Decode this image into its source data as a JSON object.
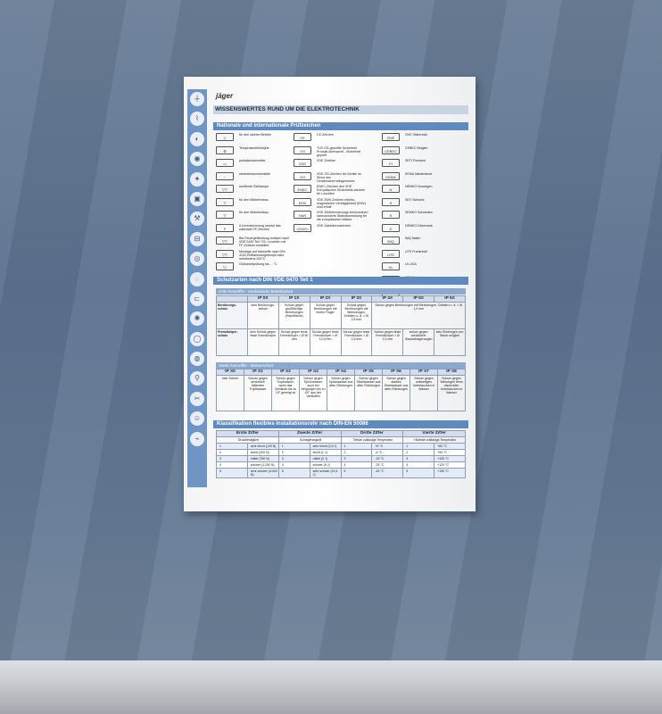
{
  "sheet": {
    "logo": "jäger",
    "main_title": "WISSENSWERTES RUND UM DIE ELEKTROTECHNIK",
    "sec1_title": "Nationale und internationale Prüfzeichen",
    "sec2_title": "Schutzarten nach DIN VDE 0470 Teil 1",
    "sec2_sub1": "erste Kennziffer - mechanische Belastbarkeit",
    "sec2_sub2": "zweite Kennziffer - Wasserschutz",
    "sec3_title": "Klassifikation flexibles Installationsrohr nach DIN-EN 50086"
  },
  "sidebar_icons": [
    "plug-icon",
    "cable-icon",
    "switch-icon",
    "socket-icon",
    "lamp-icon",
    "box-icon",
    "tool-icon",
    "fuse-icon",
    "meter-icon",
    "conduit-icon",
    "clamp-icon",
    "lamp2-icon",
    "ring-icon",
    "disc-icon",
    "screw-icon",
    "pliers-icon",
    "user-icon",
    "wire-icon"
  ],
  "col1": [
    {
      "sym": "◇",
      "text": "für den rauhen Betrieb"
    },
    {
      "sym": "⚙",
      "text": "Temperaturfühlobjekt"
    },
    {
      "sym": "▭",
      "text": "pulsationssensible"
    },
    {
      "sym": "~",
      "text": "wechselstromsensible"
    },
    {
      "sym": "▽▽",
      "text": "stoßfeste Glühlampe"
    },
    {
      "sym": "▽",
      "text": "für den Möbeleinbau"
    },
    {
      "sym": "▽",
      "text": "für den Möbeleinbau"
    },
    {
      "sym": "F",
      "text": "II-Kennzeichnung ersetzt das nationale FF-Zeichen"
    },
    {
      "sym": "▽▽",
      "text": "Bei Feuergefährdung müssen nach VDE 0100 Teil 720, Leuchten mit FF-Zeichen installiert"
    },
    {
      "sym": "▽▽",
      "text": "Montage auf baustoffe nach DIN 4102 Entflammungstempe-ratur mindestens 200°C"
    },
    {
      "sym": "°C",
      "text": "Glühdrahtprüfung bis ... °C"
    }
  ],
  "col2": [
    {
      "sym": "CE",
      "text": "CE-Zeichen"
    },
    {
      "sym": "GS",
      "text": "TÜV GS-geprüfte Sicherheit Produkt überwacht - Sicherheit geprüft"
    },
    {
      "sym": "VDE",
      "text": "VDE-Zeichen"
    },
    {
      "sym": "GS",
      "text": "VDE-GS-Zeichen für Geräte im Sinne des Gerätesicherheitsgesetzes"
    },
    {
      "sym": "ENEC",
      "text": "ENEC-Zeichen des VDE Europäisches Sicherheits-zeichen für Leuchten"
    },
    {
      "sym": "EMV",
      "text": "VDE-EMV-Zeichen elektro-magnetische Verträglichkeit (EMV) sind erfüllt"
    },
    {
      "sym": "HAR",
      "text": "VDE-Wüfinennierungs-Kennzeichen harmonisierte Starkstromleitung für die europäischen Märkte"
    },
    {
      "sym": "◁VDE▷",
      "text": "VDE-Kabelkennzeichen"
    }
  ],
  "col3": [
    {
      "sym": "ÖVE",
      "text": "ÖVE Österreich"
    },
    {
      "sym": "CEBEC",
      "text": "CEBEC Belgien"
    },
    {
      "sym": "FI",
      "text": "SETI Finnland"
    },
    {
      "sym": "KEMA",
      "text": "KEMA Niederlande"
    },
    {
      "sym": "N",
      "text": "NEMKO Norwegen"
    },
    {
      "sym": "S",
      "text": "SEV Schweiz"
    },
    {
      "sym": "S",
      "text": "SEMKO Schweden"
    },
    {
      "sym": "D",
      "text": "DEMKO Dänemark"
    },
    {
      "sym": "IMQ",
      "text": "IMQ Italien"
    },
    {
      "sym": "UTE",
      "text": "UTE Frankreich"
    },
    {
      "sym": "UL",
      "text": "UL USA"
    },
    {
      "sym": "CSA",
      "text": "CSA Kanada"
    },
    {
      "sym": "EZU",
      "text": "EZU Tschechien"
    }
  ],
  "ip_first": {
    "headers": [
      "IP 0X",
      "IP 1X",
      "IP 2X",
      "IP 3X",
      "IP 4X",
      "IP 5X",
      "IP 6X"
    ],
    "row1_label": "Berührungs-schutz",
    "row1": [
      "kein Berührungs-schutz",
      "Schutz gegen großflächige Berührungen (Handfläche)",
      "Schutz gegen Berührungen mit einem Finger",
      "Schutz gegen Berührungen mit Werkzeugen, Drähten o. ä. > Ø 2,5 mm",
      "Schutz gegen Berührungen mit Werkzeugen, Drähten o. ä. > Ø 1,0 mm"
    ],
    "row2_label": "Fremdkörper-schutz",
    "row2": [
      "kein Schutz gegen feste Fremdkörper",
      "Schutz gegen feste Fremdkörper > Ø 50 mm",
      "Schutz gegen feste Fremdkörper > Ø 12,5 mm",
      "Schutz gegen feste Fremdkörper > Ø 2,5 mm",
      "Schutz gegen feste Fremdkörper > Ø 1,0 mm",
      "schutz gegen schädliche Staubablagerungen",
      "kein Eindringen von Staub möglich"
    ]
  },
  "ip_second": {
    "headers": [
      "IP X0",
      "IP X1",
      "IP X2",
      "IP X3",
      "IP X4",
      "IP X5",
      "IP X6",
      "IP X7",
      "IP X8"
    ],
    "cells": [
      "kein Schutz",
      "Schutz gegen senkrecht fallendes Tropfwasser",
      "Schutz gegen Tropfwasser, wenn das Gehäuse bis zu 15° geneigt ist",
      "Schutz gegen Sprühwasser auch bei Neigungen bis zu 60° aus der Vertikalen",
      "Schutz gegen Spritzwasser aus allen Richtungen",
      "Schutz gegen Strahlwasser aus allen Richtungen",
      "Schutz gegen starkes Strahlwasser aus allen Richtungen",
      "Schutz gegen zeitweiliges Untertauchen in Wasser",
      "Schutz gegen Wirkungen beim dauernden Untertauchen in Wasser"
    ]
  },
  "klass": {
    "headers": [
      "Erste Ziffer",
      "Zweite Ziffer",
      "Dritte Ziffer",
      "Vierte Ziffer"
    ],
    "subheaders": [
      "Druckfestigkeit",
      "Schlagfestigkeit",
      "Tiefste zulässige Temperatur",
      "Höchste zulässige Temperatur"
    ],
    "rows": [
      [
        "1",
        "sehr leicht (125 N)",
        "1",
        "sehr leicht (0,5 J)",
        "1",
        "+5 °C",
        "1",
        "+60 °C"
      ],
      [
        "2",
        "leicht (320 N)",
        "2",
        "leicht (1 J)",
        "2",
        "-5 °C",
        "2",
        "+90 °C"
      ],
      [
        "3",
        "mittel (750 N)",
        "3",
        "mittel (2 J)",
        "3",
        "-15 °C",
        "3",
        "+105 °C"
      ],
      [
        "4",
        "schwer (1.250 N)",
        "4",
        "schwer (6 J)",
        "4",
        "-25 °C",
        "4",
        "+120 °C"
      ],
      [
        "5",
        "sehr schwer (4.000 N)",
        "5",
        "sehr schwer (20,4 J)",
        "5",
        "-45 °C",
        "5",
        "+150 °C"
      ]
    ]
  }
}
